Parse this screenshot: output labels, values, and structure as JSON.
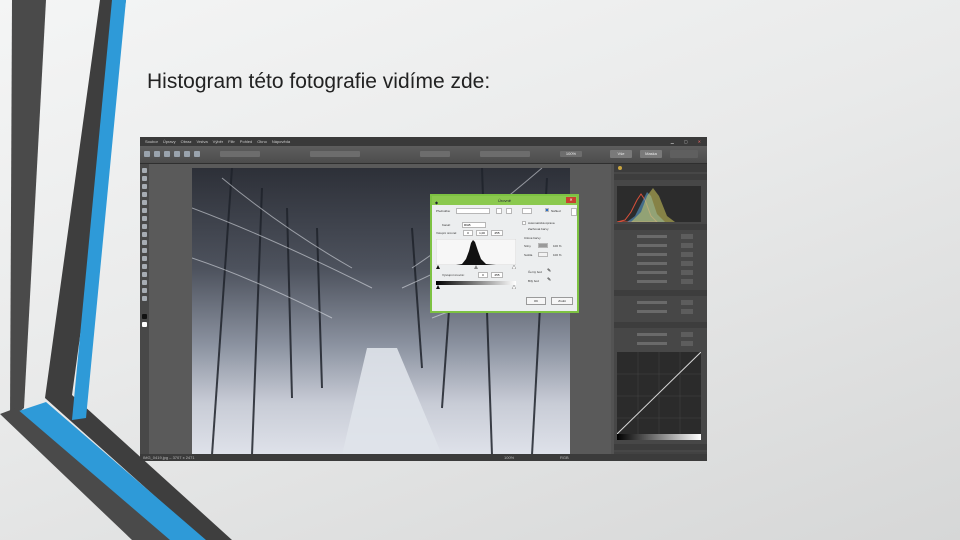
{
  "slide": {
    "title": "Histogram této fotografie vidíme zde:",
    "accent_blue": "#2f9bd8",
    "accent_dark": "#4a4a4a"
  },
  "app": {
    "menu": [
      "Soubor",
      "Úpravy",
      "Obraz",
      "Vrstva",
      "Výběr",
      "Filtr",
      "Pohled",
      "Okno",
      "Nápověda"
    ],
    "toolbar": {
      "zoom_value": "100%",
      "btn_1": "Vše",
      "btn_2": "Maska"
    },
    "status_left": "IMG_0419.jpg – 3707 x 2471",
    "status_mid": "100%",
    "status_right": "RGB"
  },
  "dialog": {
    "title": "Úrovně",
    "preset_label": "Předvolba:",
    "channel_label": "Kanál:",
    "channel_value": "RGB",
    "input_levels_label": "Vstupní úrovně:",
    "input_levels": [
      "0",
      "1,00",
      "255"
    ],
    "output_levels_label": "Výstupní úrovně:",
    "output_levels": [
      "0",
      "255"
    ],
    "auto_label": "Automaticky",
    "preview_label": "Náhled",
    "options": [
      "Automatická úprava",
      "Zachovat barvy"
    ],
    "target_colors_label": "Cílové barvy",
    "shadows_label": "Stíny",
    "highlights_label": "Světla",
    "pct_1": "100 %",
    "pct_2": "100 %",
    "black_point_label": "Černý bod",
    "white_point_label": "Bílý bod",
    "ok": "OK",
    "cancel": "Zrušit"
  },
  "histogram": {
    "color": "#111111",
    "mini_colors": [
      "#d9503a",
      "#5aa4d8",
      "#e0d860"
    ]
  }
}
